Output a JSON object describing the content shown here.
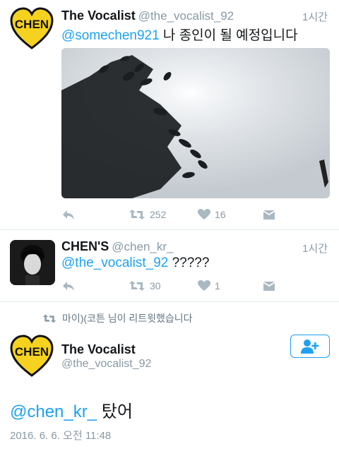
{
  "tweet1": {
    "display_name": "The Vocalist",
    "handle": "@the_vocalist_92",
    "time": "1시간",
    "mention": "@somechen921",
    "text": " 나 종인이 될 예정입니다",
    "retweet_count": "252",
    "like_count": "16"
  },
  "tweet2": {
    "display_name": "CHEN'S",
    "handle": "@chen_kr_",
    "time": "1시간",
    "mention": "@the_vocalist_92",
    "text": " ?????",
    "retweet_count": "30",
    "like_count": "1"
  },
  "retweet_context": "마이)(코튼 님이 리트윗했습니다",
  "detail": {
    "display_name": "The Vocalist",
    "handle": "@the_vocalist_92",
    "mention": "@chen_kr_",
    "text": " 탔어",
    "timestamp": "2016. 6. 6. 오전 11:48"
  },
  "avatar_logo_text": "CHEN",
  "colors": {
    "accent": "#1da1f2",
    "muted": "#8899a6",
    "heart_yellow": "#f5d21f",
    "icon_gray": "#aab8c2"
  }
}
